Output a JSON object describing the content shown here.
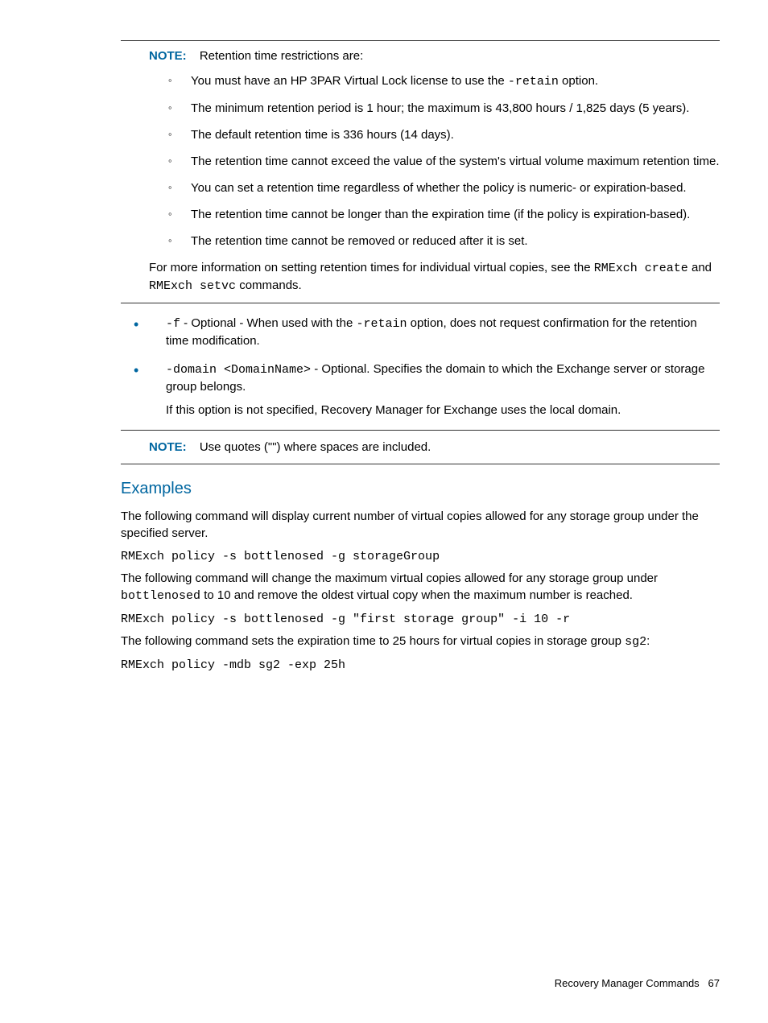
{
  "note1": {
    "label": "NOTE:",
    "intro": "Retention time restrictions are:",
    "bullets": {
      "b0_pre": "You must have an HP 3PAR Virtual Lock license to use the ",
      "b0_code": "-retain",
      "b0_post": " option.",
      "b1": "The minimum retention period is 1 hour; the maximum is 43,800 hours / 1,825 days (5 years).",
      "b2": "The default retention time is 336 hours (14 days).",
      "b3": "The retention time cannot exceed the value of the system's virtual volume maximum retention time.",
      "b4": "You can set a retention time regardless of whether the policy is numeric- or expiration-based.",
      "b5": "The retention time cannot be longer than the expiration time (if the policy is expiration-based).",
      "b6": "The retention time cannot be removed or reduced after it is set."
    },
    "para_pre": "For more information on setting retention times for individual virtual copies, see the ",
    "para_code1": "RMExch create",
    "para_mid": " and ",
    "para_code2": "RMExch setvc",
    "para_post": " commands."
  },
  "mainBullets": {
    "m0_code1": "-f",
    "m0_text1": " - Optional - When used with the ",
    "m0_code2": "-retain",
    "m0_text2": " option, does not request confirmation for the retention time modification.",
    "m1_code1": "-domain <DomainName>",
    "m1_text1": " - Optional. Specifies the domain to which the Exchange server or storage group belongs.",
    "m1_para2": "If this option is not specified, Recovery Manager for Exchange uses the local domain."
  },
  "note2": {
    "label": "NOTE:",
    "text": "Use quotes (\"\") where spaces are included."
  },
  "examples": {
    "heading": "Examples",
    "p1": "The following command will display current number of virtual copies allowed for any storage group under the specified server.",
    "cmd1": "RMExch policy -s bottlenosed -g storageGroup",
    "p2_pre": "The following command will change the maximum virtual copies allowed for any storage group under ",
    "p2_code": "bottlenosed",
    "p2_post": " to 10 and remove the oldest virtual copy when the maximum number is reached.",
    "cmd2": "RMExch policy -s bottlenosed -g \"first storage group\" -i 10 -r",
    "p3_pre": "The following command sets the expiration time to 25 hours for virtual copies in storage group ",
    "p3_code": "sg2",
    "p3_post": ":",
    "cmd3": "RMExch policy -mdb sg2 -exp 25h"
  },
  "footer": {
    "text": "Recovery Manager Commands",
    "page": "67"
  }
}
